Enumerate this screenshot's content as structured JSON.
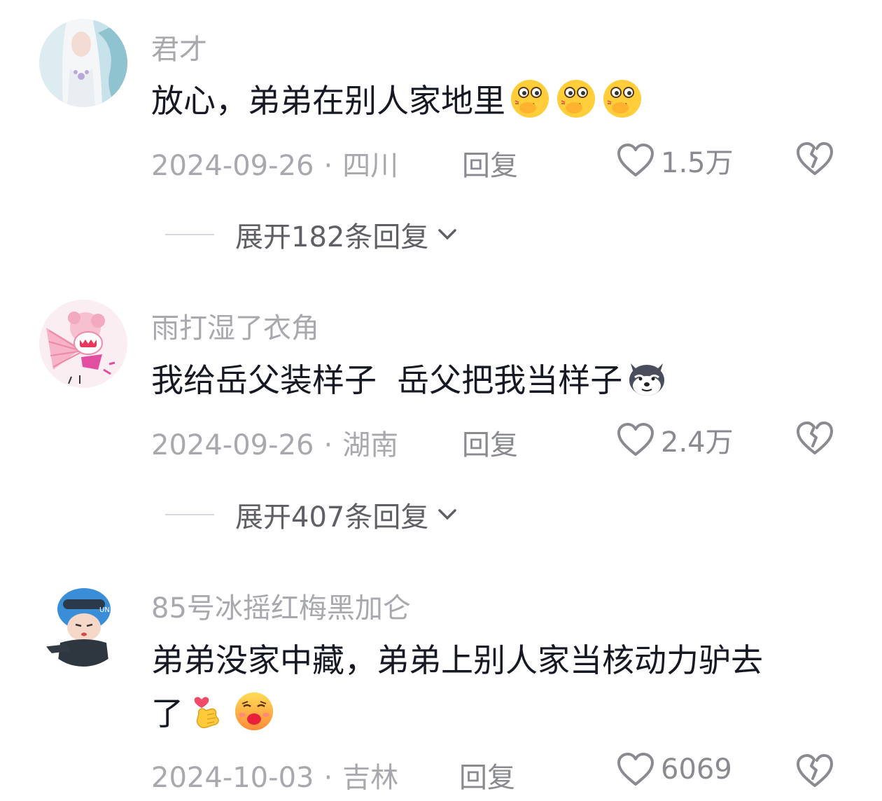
{
  "comments": [
    {
      "username": "君才",
      "text": "放心，弟弟在别人家地里",
      "emojis": [
        "blush-face-emoji",
        "blush-face-emoji",
        "blush-face-emoji"
      ],
      "date": "2024-09-26",
      "location": "四川",
      "reply_label": "回复",
      "likes": "1.5万",
      "expand_label": "展开182条回复",
      "avatar": "avatar-white-haired-character"
    },
    {
      "username": "雨打湿了衣角",
      "text": "我给岳父装样子  岳父把我当样子",
      "emojis": [
        "husky-dog-emoji"
      ],
      "date": "2024-09-26",
      "location": "湖南",
      "reply_label": "回复",
      "likes": "2.4万",
      "expand_label": "展开407条回复",
      "avatar": "avatar-pink-anime-girl"
    },
    {
      "username": "85号冰摇红梅黑加仑",
      "text_line1": "弟弟没家中藏，弟弟上别人家当核动力驴去",
      "text_line2": "了",
      "emojis": [
        "finger-heart-emoji",
        "kissing-face-emoji"
      ],
      "date": "2024-10-03",
      "location": "吉林",
      "reply_label": "回复",
      "likes": "6069",
      "avatar": "avatar-chibi-soldier"
    }
  ],
  "colors": {
    "username": "#a8a9ae",
    "text": "#161823",
    "meta": "#a8a9ae",
    "action": "#8a8b91"
  }
}
